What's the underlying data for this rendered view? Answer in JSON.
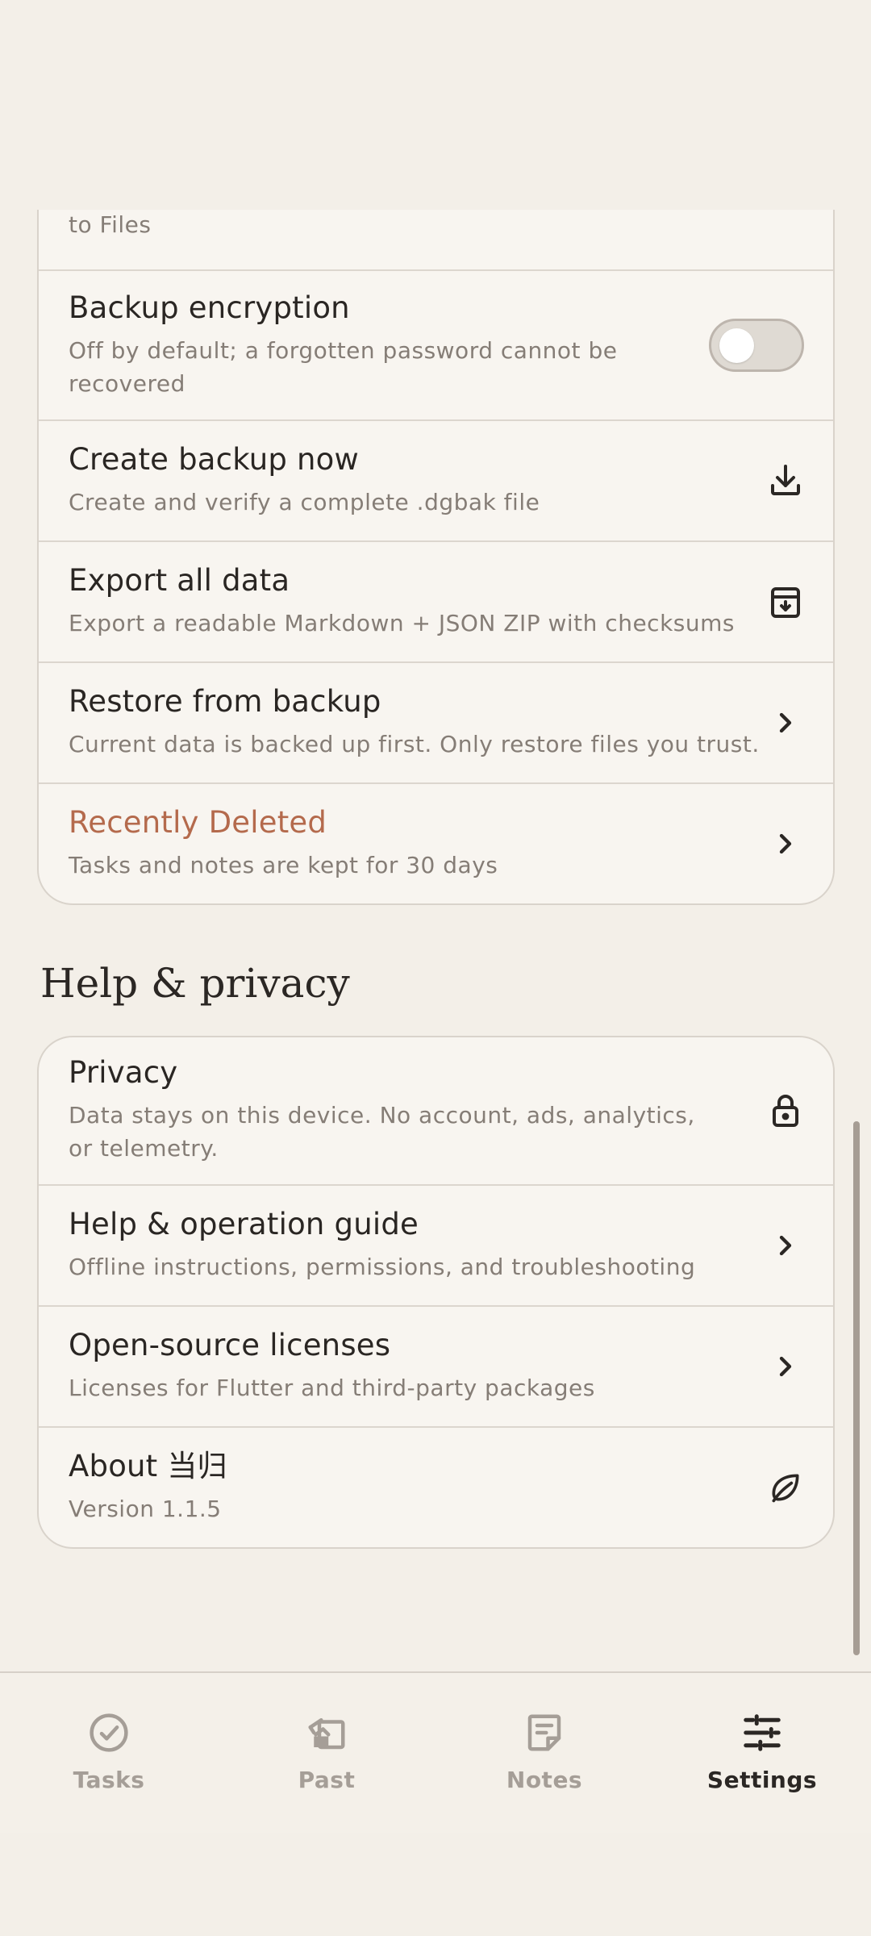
{
  "backup_card": {
    "partial_row": {
      "subtitle": "Daily copies stay in app; manual copies can be saved to Files"
    },
    "encryption": {
      "title": "Backup encryption",
      "subtitle": "Off by default; a forgotten password cannot be recovered",
      "enabled": false
    },
    "create_backup": {
      "title": "Create backup now",
      "subtitle": "Create and verify a complete .dgbak file",
      "icon": "download-icon"
    },
    "export": {
      "title": "Export all data",
      "subtitle": "Export a readable Markdown + JSON ZIP with checksums",
      "icon": "archive-download-icon"
    },
    "restore": {
      "title": "Restore from backup",
      "subtitle": "Current data is backed up first. Only restore files you trust.",
      "icon": "chevron-right-icon"
    },
    "recently_deleted": {
      "title": "Recently Deleted",
      "subtitle": "Tasks and notes are kept for 30 days",
      "icon": "chevron-right-icon",
      "accent_color": "#b46a4c"
    }
  },
  "help_section": {
    "heading": "Help & privacy",
    "privacy": {
      "title": "Privacy",
      "subtitle": "Data stays on this device. No account, ads, analytics, or telemetry.",
      "icon": "lock-icon"
    },
    "guide": {
      "title": "Help & operation guide",
      "subtitle": "Offline instructions, permissions, and troubleshooting",
      "icon": "chevron-right-icon"
    },
    "licenses": {
      "title": "Open-source licenses",
      "subtitle": "Licenses for Flutter and third-party packages",
      "icon": "chevron-right-icon"
    },
    "about": {
      "title": "About 当归",
      "subtitle": "Version 1.1.5",
      "icon": "leaf-icon"
    }
  },
  "bottom_nav": {
    "items": [
      {
        "label": "Tasks",
        "icon": "check-circle-icon",
        "active": false
      },
      {
        "label": "Past",
        "icon": "past-icon",
        "active": false
      },
      {
        "label": "Notes",
        "icon": "note-icon",
        "active": false
      },
      {
        "label": "Settings",
        "icon": "sliders-icon",
        "active": true
      }
    ]
  }
}
